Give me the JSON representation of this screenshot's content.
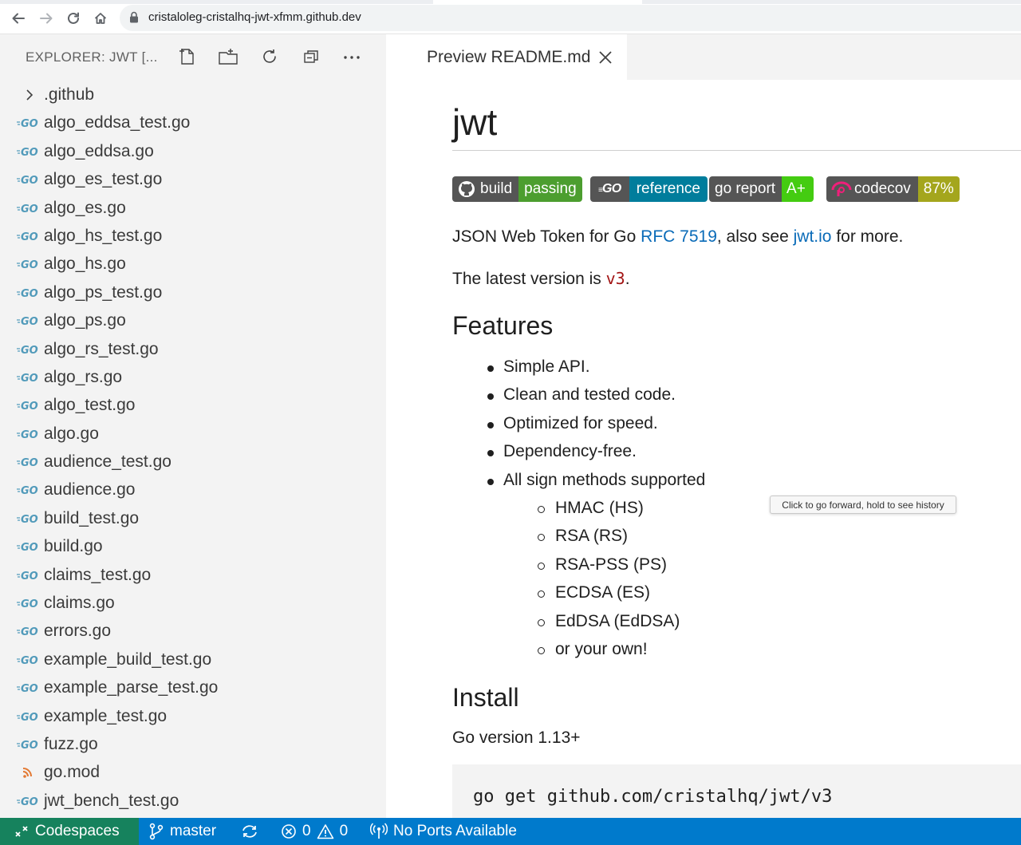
{
  "browser": {
    "url": "cristaloleg-cristalhq-jwt-xfmm.github.dev",
    "nav": [
      "back-icon",
      "forward-icon",
      "reload-icon",
      "home-icon"
    ]
  },
  "sidebar": {
    "title": "EXPLORER: JWT [...",
    "actions": [
      "new-file-icon",
      "new-folder-icon",
      "refresh-icon",
      "collapse-all-icon",
      "more-icon"
    ],
    "files": [
      {
        "name": ".github",
        "type": "folder"
      },
      {
        "name": "algo_eddsa_test.go",
        "type": "go"
      },
      {
        "name": "algo_eddsa.go",
        "type": "go"
      },
      {
        "name": "algo_es_test.go",
        "type": "go"
      },
      {
        "name": "algo_es.go",
        "type": "go"
      },
      {
        "name": "algo_hs_test.go",
        "type": "go"
      },
      {
        "name": "algo_hs.go",
        "type": "go"
      },
      {
        "name": "algo_ps_test.go",
        "type": "go"
      },
      {
        "name": "algo_ps.go",
        "type": "go"
      },
      {
        "name": "algo_rs_test.go",
        "type": "go"
      },
      {
        "name": "algo_rs.go",
        "type": "go"
      },
      {
        "name": "algo_test.go",
        "type": "go"
      },
      {
        "name": "algo.go",
        "type": "go"
      },
      {
        "name": "audience_test.go",
        "type": "go"
      },
      {
        "name": "audience.go",
        "type": "go"
      },
      {
        "name": "build_test.go",
        "type": "go"
      },
      {
        "name": "build.go",
        "type": "go"
      },
      {
        "name": "claims_test.go",
        "type": "go"
      },
      {
        "name": "claims.go",
        "type": "go"
      },
      {
        "name": "errors.go",
        "type": "go"
      },
      {
        "name": "example_build_test.go",
        "type": "go"
      },
      {
        "name": "example_parse_test.go",
        "type": "go"
      },
      {
        "name": "example_test.go",
        "type": "go"
      },
      {
        "name": "fuzz.go",
        "type": "go"
      },
      {
        "name": "go.mod",
        "type": "mod"
      },
      {
        "name": "jwt_bench_test.go",
        "type": "go"
      }
    ]
  },
  "editor": {
    "tab_label": "Preview README.md",
    "title": "jwt",
    "badges": [
      {
        "left": "build",
        "right": "passing",
        "color": "#4c9e2f",
        "icon": "github-icon"
      },
      {
        "left": "GO",
        "right": "reference",
        "color": "#007d9c",
        "icon": "go-icon"
      },
      {
        "left": "go report",
        "right": "A+",
        "color": "#44cc11",
        "icon": ""
      },
      {
        "left": "codecov",
        "right": "87%",
        "color": "#a4a61d",
        "icon": "codecov-icon"
      }
    ],
    "intro": {
      "prefix": "JSON Web Token for Go ",
      "link1": "RFC 7519",
      "middle": ", also see ",
      "link2": "jwt.io",
      "suffix": " for more."
    },
    "version": {
      "prefix": "The latest version is ",
      "code": "v3",
      "suffix": "."
    },
    "features_heading": "Features",
    "features": [
      "Simple API.",
      "Clean and tested code.",
      "Optimized for speed.",
      "Dependency-free.",
      "All sign methods supported"
    ],
    "sign_methods": [
      "HMAC (HS)",
      "RSA (RS)",
      "RSA-PSS (PS)",
      "ECDSA (ES)",
      "EdDSA (EdDSA)",
      "or your own!"
    ],
    "install_heading": "Install",
    "go_version": "Go version 1.13+",
    "install_cmd": "go get github.com/cristalhq/jwt/v3"
  },
  "tooltip": "Click to go forward, hold to see history",
  "statusbar": {
    "remote": "Codespaces",
    "branch": "master",
    "errors": "0",
    "warnings": "0",
    "ports": "No Ports Available"
  }
}
